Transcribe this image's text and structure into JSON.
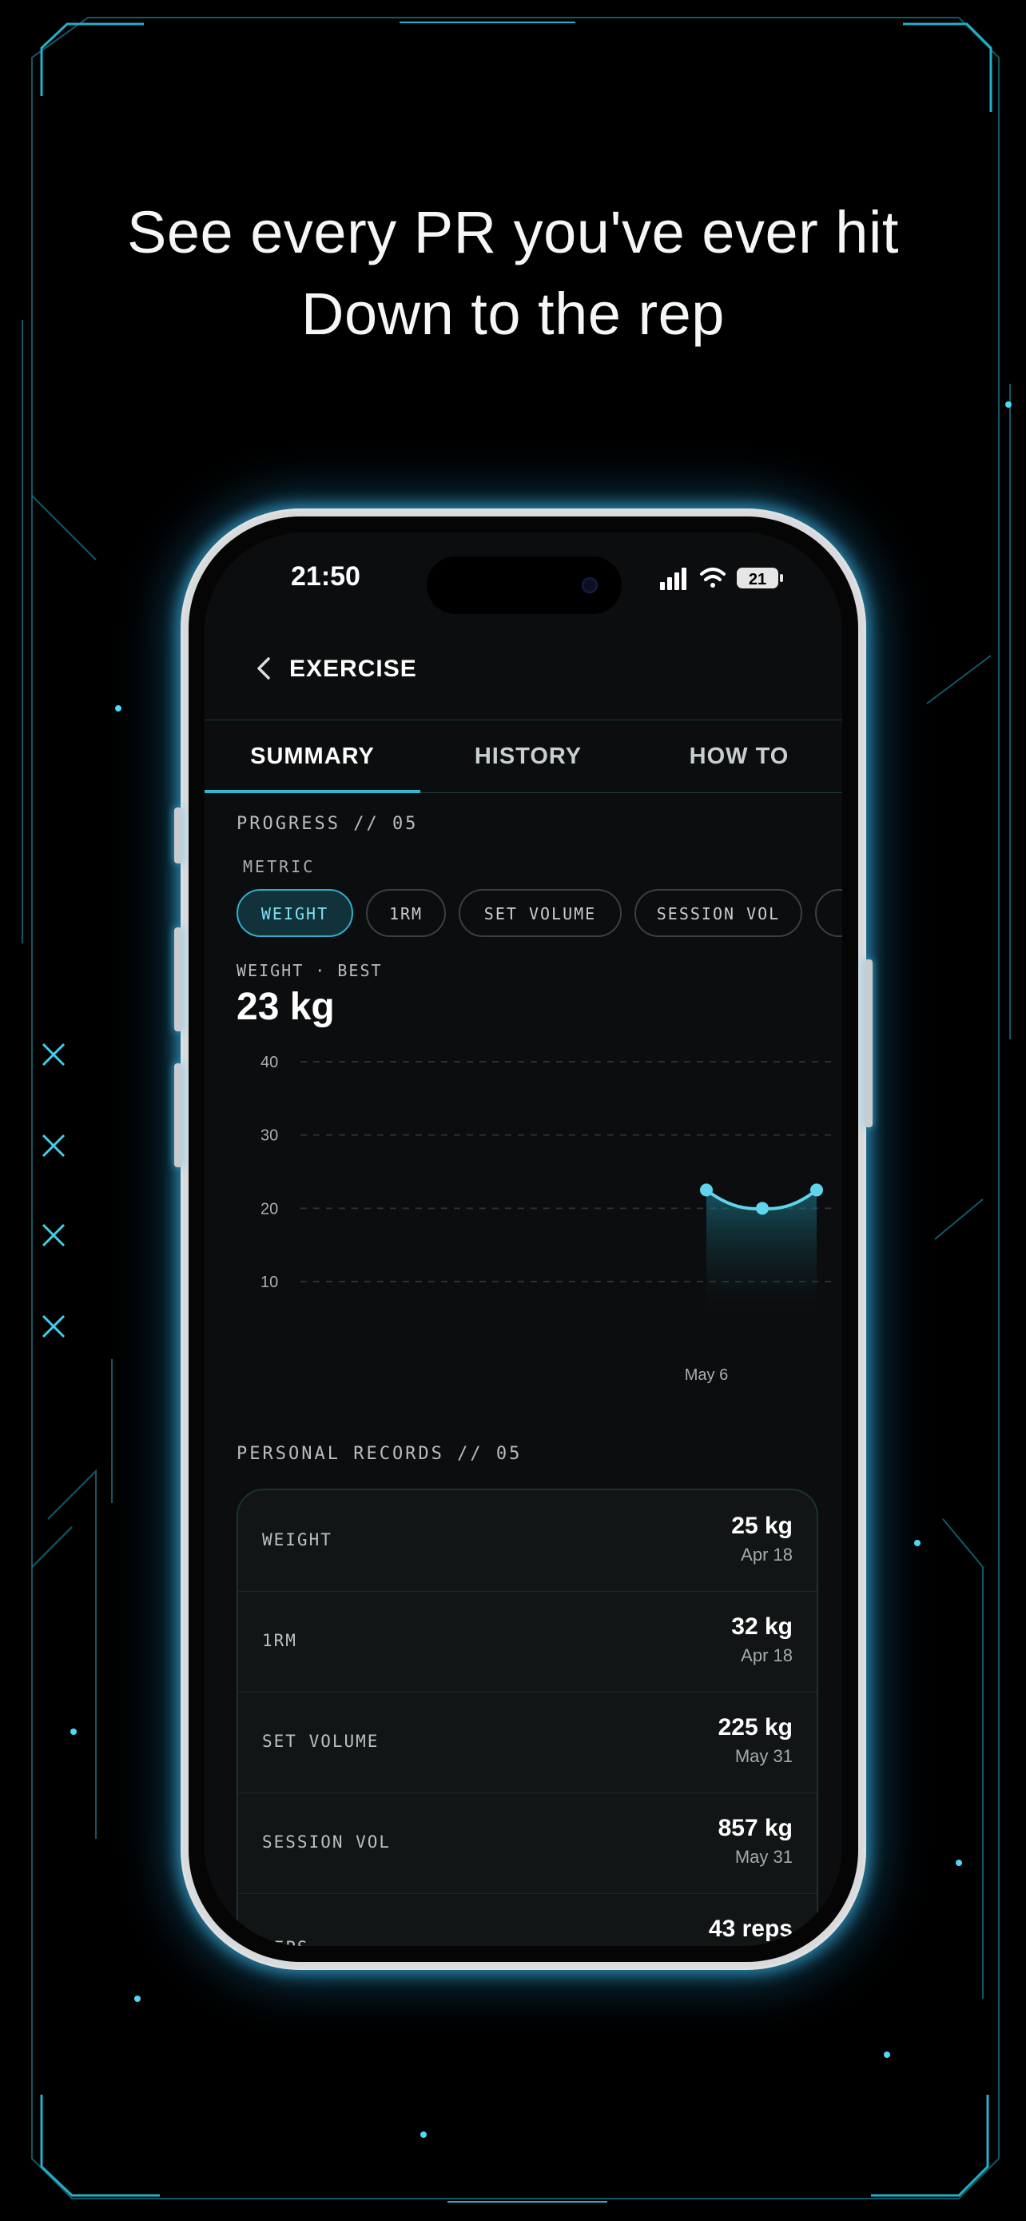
{
  "headline": {
    "line1": "See every PR you've ever hit",
    "line2": "Down to the rep"
  },
  "status_bar": {
    "time": "21:50",
    "battery": "21"
  },
  "nav": {
    "back_icon": "chevron-left-icon",
    "title": "EXERCISE"
  },
  "tabs": [
    {
      "label": "SUMMARY",
      "active": true
    },
    {
      "label": "HISTORY",
      "active": false
    },
    {
      "label": "HOW TO",
      "active": false
    }
  ],
  "progress": {
    "section_label": "PROGRESS // 05",
    "metric_label": "METRIC",
    "chips": [
      {
        "label": "WEIGHT",
        "active": true
      },
      {
        "label": "1RM",
        "active": false
      },
      {
        "label": "SET VOLUME",
        "active": false
      },
      {
        "label": "SESSION VOL",
        "active": false
      }
    ],
    "best_label": "WEIGHT · BEST",
    "best_value": "23 kg"
  },
  "chart_data": {
    "type": "area",
    "x_tick_label": "May 6",
    "ylim": [
      0,
      40
    ],
    "y_ticks": [
      "40",
      "30",
      "20",
      "10"
    ],
    "grid": true,
    "series": [
      {
        "values": [
          22.5,
          20,
          22.5
        ]
      }
    ],
    "line_color": "#5fd4ec"
  },
  "records": {
    "section_label": "PERSONAL RECORDS // 05",
    "rows": [
      {
        "name": "WEIGHT",
        "value": "25 kg",
        "date": "Apr 18"
      },
      {
        "name": "1RM",
        "value": "32 kg",
        "date": "Apr 18"
      },
      {
        "name": "SET VOLUME",
        "value": "225 kg",
        "date": "May 31"
      },
      {
        "name": "SESSION VOL",
        "value": "857 kg",
        "date": "May 31"
      },
      {
        "name": "REPS",
        "value": "43 reps",
        "date": ""
      }
    ]
  },
  "colors": {
    "accent": "#2fb8d4",
    "background": "#000000",
    "screen": "#0c0d0e"
  }
}
